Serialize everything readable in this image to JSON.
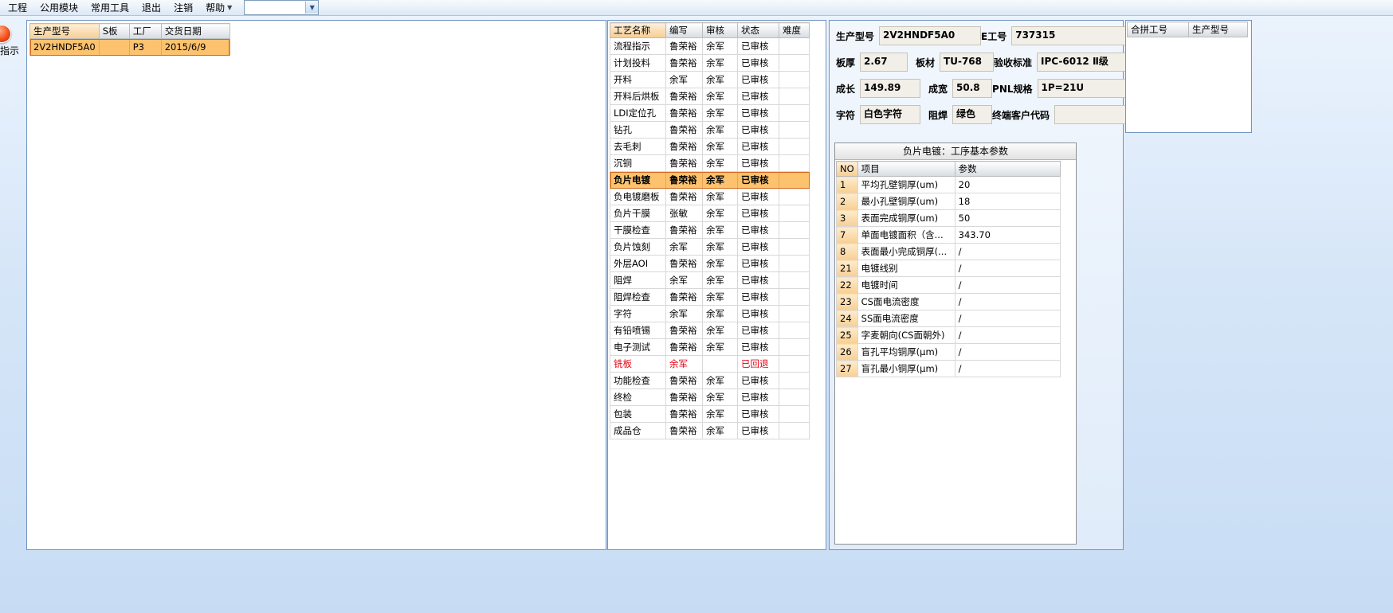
{
  "colors": {
    "selected_row": "#fcc26d",
    "selected_border": "#d2691e",
    "alert_text": "#e3000e",
    "header_highlight": "#f6cd92"
  },
  "menu": {
    "items": [
      "工程",
      "公用模块",
      "常用工具",
      "退出",
      "注销",
      "帮助"
    ],
    "combo_value": ""
  },
  "side_tool": {
    "label": "指示"
  },
  "orders_table": {
    "headers": [
      "生产型号",
      "S板",
      "工厂",
      "交货日期"
    ],
    "rows": [
      {
        "cells": [
          "2V2HNDF5A0",
          "",
          "P3",
          "2015/6/9"
        ],
        "selected": true
      }
    ]
  },
  "process_table": {
    "headers": [
      "工艺名称",
      "编写",
      "审核",
      "状态",
      "难度"
    ],
    "rows": [
      {
        "cells": [
          "流程指示",
          "鲁荣裕",
          "余军",
          "已审核",
          ""
        ]
      },
      {
        "cells": [
          "计划投料",
          "鲁荣裕",
          "余军",
          "已审核",
          ""
        ]
      },
      {
        "cells": [
          "开料",
          "余军",
          "余军",
          "已审核",
          ""
        ]
      },
      {
        "cells": [
          "开料后烘板",
          "鲁荣裕",
          "余军",
          "已审核",
          ""
        ]
      },
      {
        "cells": [
          "LDI定位孔",
          "鲁荣裕",
          "余军",
          "已审核",
          ""
        ]
      },
      {
        "cells": [
          "钻孔",
          "鲁荣裕",
          "余军",
          "已审核",
          ""
        ]
      },
      {
        "cells": [
          "去毛刺",
          "鲁荣裕",
          "余军",
          "已审核",
          ""
        ]
      },
      {
        "cells": [
          "沉铜",
          "鲁荣裕",
          "余军",
          "已审核",
          ""
        ]
      },
      {
        "cells": [
          "负片电镀",
          "鲁荣裕",
          "余军",
          "已审核",
          ""
        ],
        "selected": true
      },
      {
        "cells": [
          "负电镀磨板",
          "鲁荣裕",
          "余军",
          "已审核",
          ""
        ]
      },
      {
        "cells": [
          "负片干膜",
          "张敏",
          "余军",
          "已审核",
          ""
        ]
      },
      {
        "cells": [
          "干膜检查",
          "鲁荣裕",
          "余军",
          "已审核",
          ""
        ]
      },
      {
        "cells": [
          "负片蚀刻",
          "余军",
          "余军",
          "已审核",
          ""
        ]
      },
      {
        "cells": [
          "外层AOI",
          "鲁荣裕",
          "余军",
          "已审核",
          ""
        ]
      },
      {
        "cells": [
          "阻焊",
          "余军",
          "余军",
          "已审核",
          ""
        ]
      },
      {
        "cells": [
          "阻焊检查",
          "鲁荣裕",
          "余军",
          "已审核",
          ""
        ]
      },
      {
        "cells": [
          "字符",
          "余军",
          "余军",
          "已审核",
          ""
        ]
      },
      {
        "cells": [
          "有铅喷锡",
          "鲁荣裕",
          "余军",
          "已审核",
          ""
        ]
      },
      {
        "cells": [
          "电子测试",
          "鲁荣裕",
          "余军",
          "已审核",
          ""
        ]
      },
      {
        "cells": [
          "铣板",
          "余军",
          "",
          "已回退",
          ""
        ],
        "alert": true
      },
      {
        "cells": [
          "功能检查",
          "鲁荣裕",
          "余军",
          "已审核",
          ""
        ]
      },
      {
        "cells": [
          "终检",
          "鲁荣裕",
          "余军",
          "已审核",
          ""
        ]
      },
      {
        "cells": [
          "包装",
          "鲁荣裕",
          "余军",
          "已审核",
          ""
        ]
      },
      {
        "cells": [
          "成品仓",
          "鲁荣裕",
          "余军",
          "已审核",
          ""
        ]
      }
    ]
  },
  "form": {
    "model": {
      "label": "生产型号",
      "value": "2V2HNDF5A0"
    },
    "e_no": {
      "label": "E工号",
      "value": "737315"
    },
    "thickness": {
      "label": "板厚",
      "value": "2.67"
    },
    "material": {
      "label": "板材",
      "value": "TU-768"
    },
    "standard": {
      "label": "验收标准",
      "value": "IPC-6012 Ⅱ级"
    },
    "length": {
      "label": "成长",
      "value": "149.89"
    },
    "width": {
      "label": "成宽",
      "value": "50.8"
    },
    "pnl": {
      "label": "PNL规格",
      "value": "1P=21U"
    },
    "silkscreen": {
      "label": "字符",
      "value": "白色字符"
    },
    "soldermask": {
      "label": "阻焊",
      "value": "绿色"
    },
    "client_code": {
      "label": "终端客户代码",
      "value": ""
    }
  },
  "params_panel": {
    "title": "负片电镀：工序基本参数",
    "headers": [
      "NO",
      "项目",
      "参数"
    ],
    "rows": [
      {
        "cells": [
          "1",
          "平均孔壁铜厚(um)",
          "20"
        ]
      },
      {
        "cells": [
          "2",
          "最小孔壁铜厚(um)",
          "18"
        ]
      },
      {
        "cells": [
          "3",
          "表面完成铜厚(um)",
          "50"
        ]
      },
      {
        "cells": [
          "7",
          "单面电镀面积（含...",
          "343.70"
        ]
      },
      {
        "cells": [
          "8",
          "表面最小完成铜厚(...",
          "/"
        ]
      },
      {
        "cells": [
          "21",
          "电镀线别",
          "/"
        ]
      },
      {
        "cells": [
          "22",
          "电镀时间",
          "/"
        ]
      },
      {
        "cells": [
          "23",
          "CS面电流密度",
          "/"
        ]
      },
      {
        "cells": [
          "24",
          "SS面电流密度",
          "/"
        ]
      },
      {
        "cells": [
          "25",
          "字麦朝向(CS面朝外)",
          "/"
        ]
      },
      {
        "cells": [
          "26",
          "盲孔平均铜厚(μm)",
          "/"
        ]
      },
      {
        "cells": [
          "27",
          "盲孔最小铜厚(μm)",
          "/"
        ]
      }
    ]
  },
  "merge_table": {
    "headers": [
      "合拼工号",
      "生产型号"
    ]
  }
}
